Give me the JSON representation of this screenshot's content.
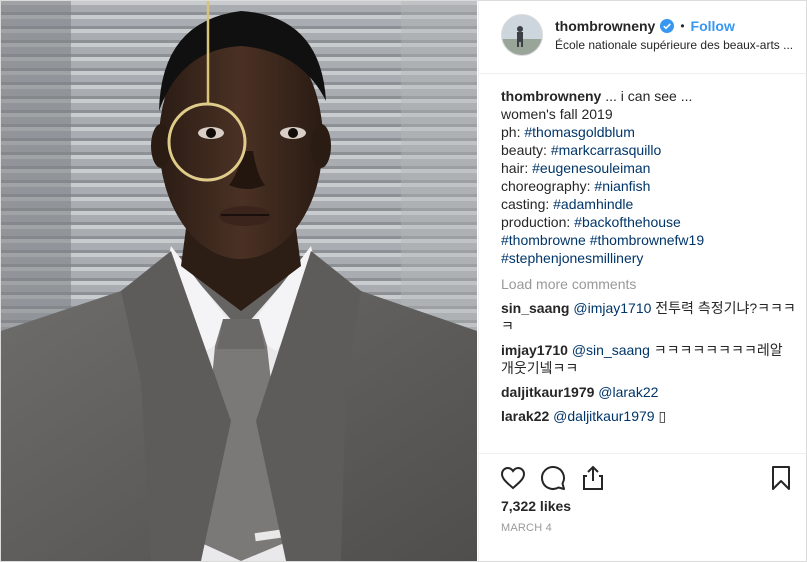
{
  "header": {
    "username": "thombrowneny",
    "separator": "•",
    "follow_label": "Follow",
    "location": "École nationale supérieure des beaux-arts ...",
    "verified_icon": "verified-badge-icon",
    "accent_color": "#3897f0"
  },
  "caption": {
    "username": "thombrowneny",
    "text": " ... i can see ...",
    "lines": [
      {
        "prefix": "women's fall 2019",
        "tags": []
      },
      {
        "prefix": "ph: ",
        "tags": [
          "#thomasgoldblum"
        ]
      },
      {
        "prefix": "beauty: ",
        "tags": [
          "#markcarrasquillo"
        ]
      },
      {
        "prefix": "hair: ",
        "tags": [
          "#eugenesouleiman"
        ]
      },
      {
        "prefix": "choreography: ",
        "tags": [
          "#nianfish"
        ]
      },
      {
        "prefix": "casting: ",
        "tags": [
          "#adamhindle"
        ]
      },
      {
        "prefix": "production: ",
        "tags": [
          "#backofthehouse"
        ]
      },
      {
        "prefix": "",
        "tags": [
          "#thombrowne",
          "#thombrownefw19"
        ]
      },
      {
        "prefix": "",
        "tags": [
          "#stephenjonesmillinery"
        ]
      }
    ]
  },
  "load_more_label": "Load more comments",
  "comments": [
    {
      "username": "sin_saang",
      "mention": "@imjay1710",
      "text": " 전투력 측정기냐?ㅋㅋㅋㅋ"
    },
    {
      "username": "imjay1710",
      "mention": "@sin_saang",
      "text": " ㅋㅋㅋㅋㅋㅋㅋㅋ레알 개웃기넼ㅋㅋ"
    },
    {
      "username": "daljitkaur1979",
      "mention": "@larak22",
      "text": ""
    },
    {
      "username": "larak22",
      "mention": "@daljitkaur1979",
      "text": " ▯"
    }
  ],
  "actions": {
    "like_icon": "heart-icon",
    "comment_icon": "comment-icon",
    "share_icon": "share-icon",
    "save_icon": "bookmark-icon"
  },
  "likes": "7,322 likes",
  "date": "MARCH 4",
  "colors": {
    "link": "#003569",
    "muted": "#999999",
    "border": "#efefef"
  }
}
